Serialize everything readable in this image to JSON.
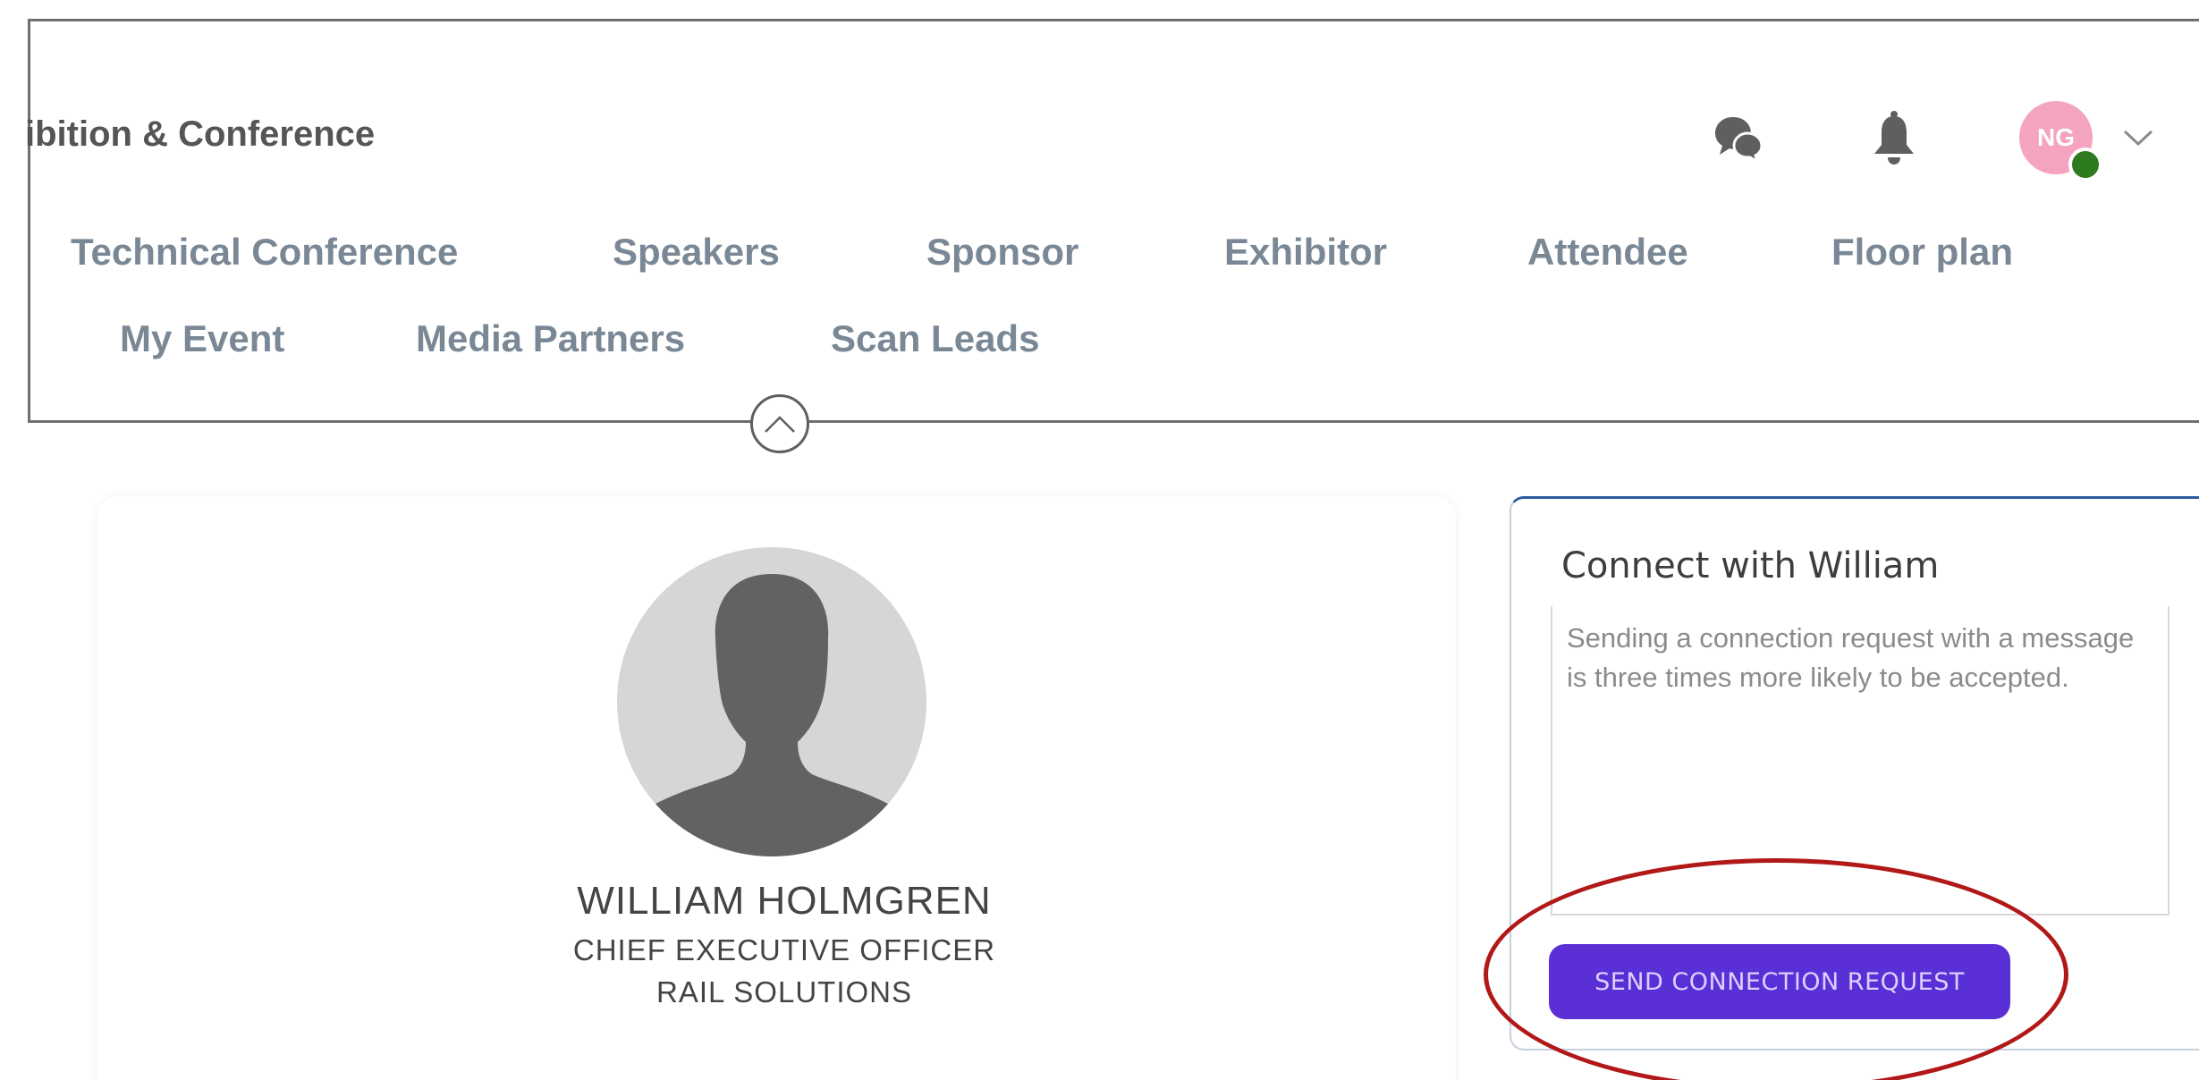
{
  "header": {
    "event_title": "ibition & Conference",
    "avatar_initials": "NG"
  },
  "nav": {
    "row1": [
      "Technical Conference",
      "Speakers",
      "Sponsor",
      "Exhibitor",
      "Attendee",
      "Floor plan"
    ],
    "row2": [
      "My Event",
      "Media Partners",
      "Scan Leads"
    ]
  },
  "profile": {
    "name": "WILLIAM HOLMGREN",
    "title": "CHIEF EXECUTIVE OFFICER",
    "company": "RAIL SOLUTIONS"
  },
  "connect": {
    "heading": "Connect with William",
    "placeholder": "Sending a connection request with a message is three times more likely to be accepted.",
    "send_label": "SEND CONNECTION REQUEST"
  },
  "colors": {
    "nav_text": "#7a8896",
    "avatar_bg": "#f4a3c0",
    "online_status": "#2d7a1f",
    "send_button": "#5b2fd6",
    "highlight": "#b11818"
  },
  "icons": [
    "chat-icon",
    "bell-icon",
    "chevron-down-icon",
    "chevron-up-icon",
    "person-silhouette-icon"
  ]
}
